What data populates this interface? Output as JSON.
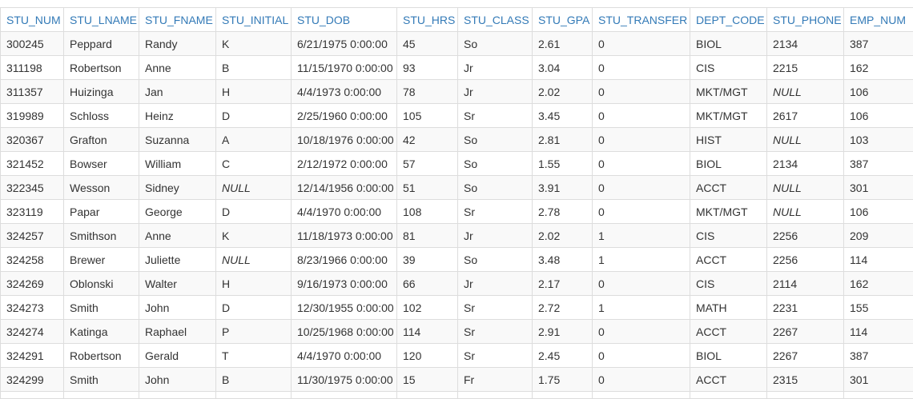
{
  "table": {
    "columns": [
      "STU_NUM",
      "STU_LNAME",
      "STU_FNAME",
      "STU_INITIAL",
      "STU_DOB",
      "STU_HRS",
      "STU_CLASS",
      "STU_GPA",
      "STU_TRANSFER",
      "DEPT_CODE",
      "STU_PHONE",
      "EMP_NUM"
    ],
    "rows": [
      [
        "300245",
        "Peppard",
        "Randy",
        "K",
        "6/21/1975 0:00:00",
        "45",
        "So",
        "2.61",
        "0",
        "BIOL",
        "2134",
        "387"
      ],
      [
        "311198",
        "Robertson",
        "Anne",
        "B",
        "11/15/1970 0:00:00",
        "93",
        "Jr",
        "3.04",
        "0",
        "CIS",
        "2215",
        "162"
      ],
      [
        "311357",
        "Huizinga",
        "Jan",
        "H",
        "4/4/1973 0:00:00",
        "78",
        "Jr",
        "2.02",
        "0",
        "MKT/MGT",
        "NULL",
        "106"
      ],
      [
        "319989",
        "Schloss",
        "Heinz",
        "D",
        "2/25/1960 0:00:00",
        "105",
        "Sr",
        "3.45",
        "0",
        "MKT/MGT",
        "2617",
        "106"
      ],
      [
        "320367",
        "Grafton",
        "Suzanna",
        "A",
        "10/18/1976 0:00:00",
        "42",
        "So",
        "2.81",
        "0",
        "HIST",
        "NULL",
        "103"
      ],
      [
        "321452",
        "Bowser",
        "William",
        "C",
        "2/12/1972 0:00:00",
        "57",
        "So",
        "1.55",
        "0",
        "BIOL",
        "2134",
        "387"
      ],
      [
        "322345",
        "Wesson",
        "Sidney",
        "NULL",
        "12/14/1956 0:00:00",
        "51",
        "So",
        "3.91",
        "0",
        "ACCT",
        "NULL",
        "301"
      ],
      [
        "323119",
        "Papar",
        "George",
        "D",
        "4/4/1970 0:00:00",
        "108",
        "Sr",
        "2.78",
        "0",
        "MKT/MGT",
        "NULL",
        "106"
      ],
      [
        "324257",
        "Smithson",
        "Anne",
        "K",
        "11/18/1973 0:00:00",
        "81",
        "Jr",
        "2.02",
        "1",
        "CIS",
        "2256",
        "209"
      ],
      [
        "324258",
        "Brewer",
        "Juliette",
        "NULL",
        "8/23/1966 0:00:00",
        "39",
        "So",
        "3.48",
        "1",
        "ACCT",
        "2256",
        "114"
      ],
      [
        "324269",
        "Oblonski",
        "Walter",
        "H",
        "9/16/1973 0:00:00",
        "66",
        "Jr",
        "2.17",
        "0",
        "CIS",
        "2114",
        "162"
      ],
      [
        "324273",
        "Smith",
        "John",
        "D",
        "12/30/1955 0:00:00",
        "102",
        "Sr",
        "2.72",
        "1",
        "MATH",
        "2231",
        "155"
      ],
      [
        "324274",
        "Katinga",
        "Raphael",
        "P",
        "10/25/1968 0:00:00",
        "114",
        "Sr",
        "2.91",
        "0",
        "ACCT",
        "2267",
        "114"
      ],
      [
        "324291",
        "Robertson",
        "Gerald",
        "T",
        "4/4/1970 0:00:00",
        "120",
        "Sr",
        "2.45",
        "0",
        "BIOL",
        "2267",
        "387"
      ],
      [
        "324299",
        "Smith",
        "John",
        "B",
        "11/30/1975 0:00:00",
        "15",
        "Fr",
        "1.75",
        "0",
        "ACCT",
        "2315",
        "301"
      ]
    ]
  }
}
